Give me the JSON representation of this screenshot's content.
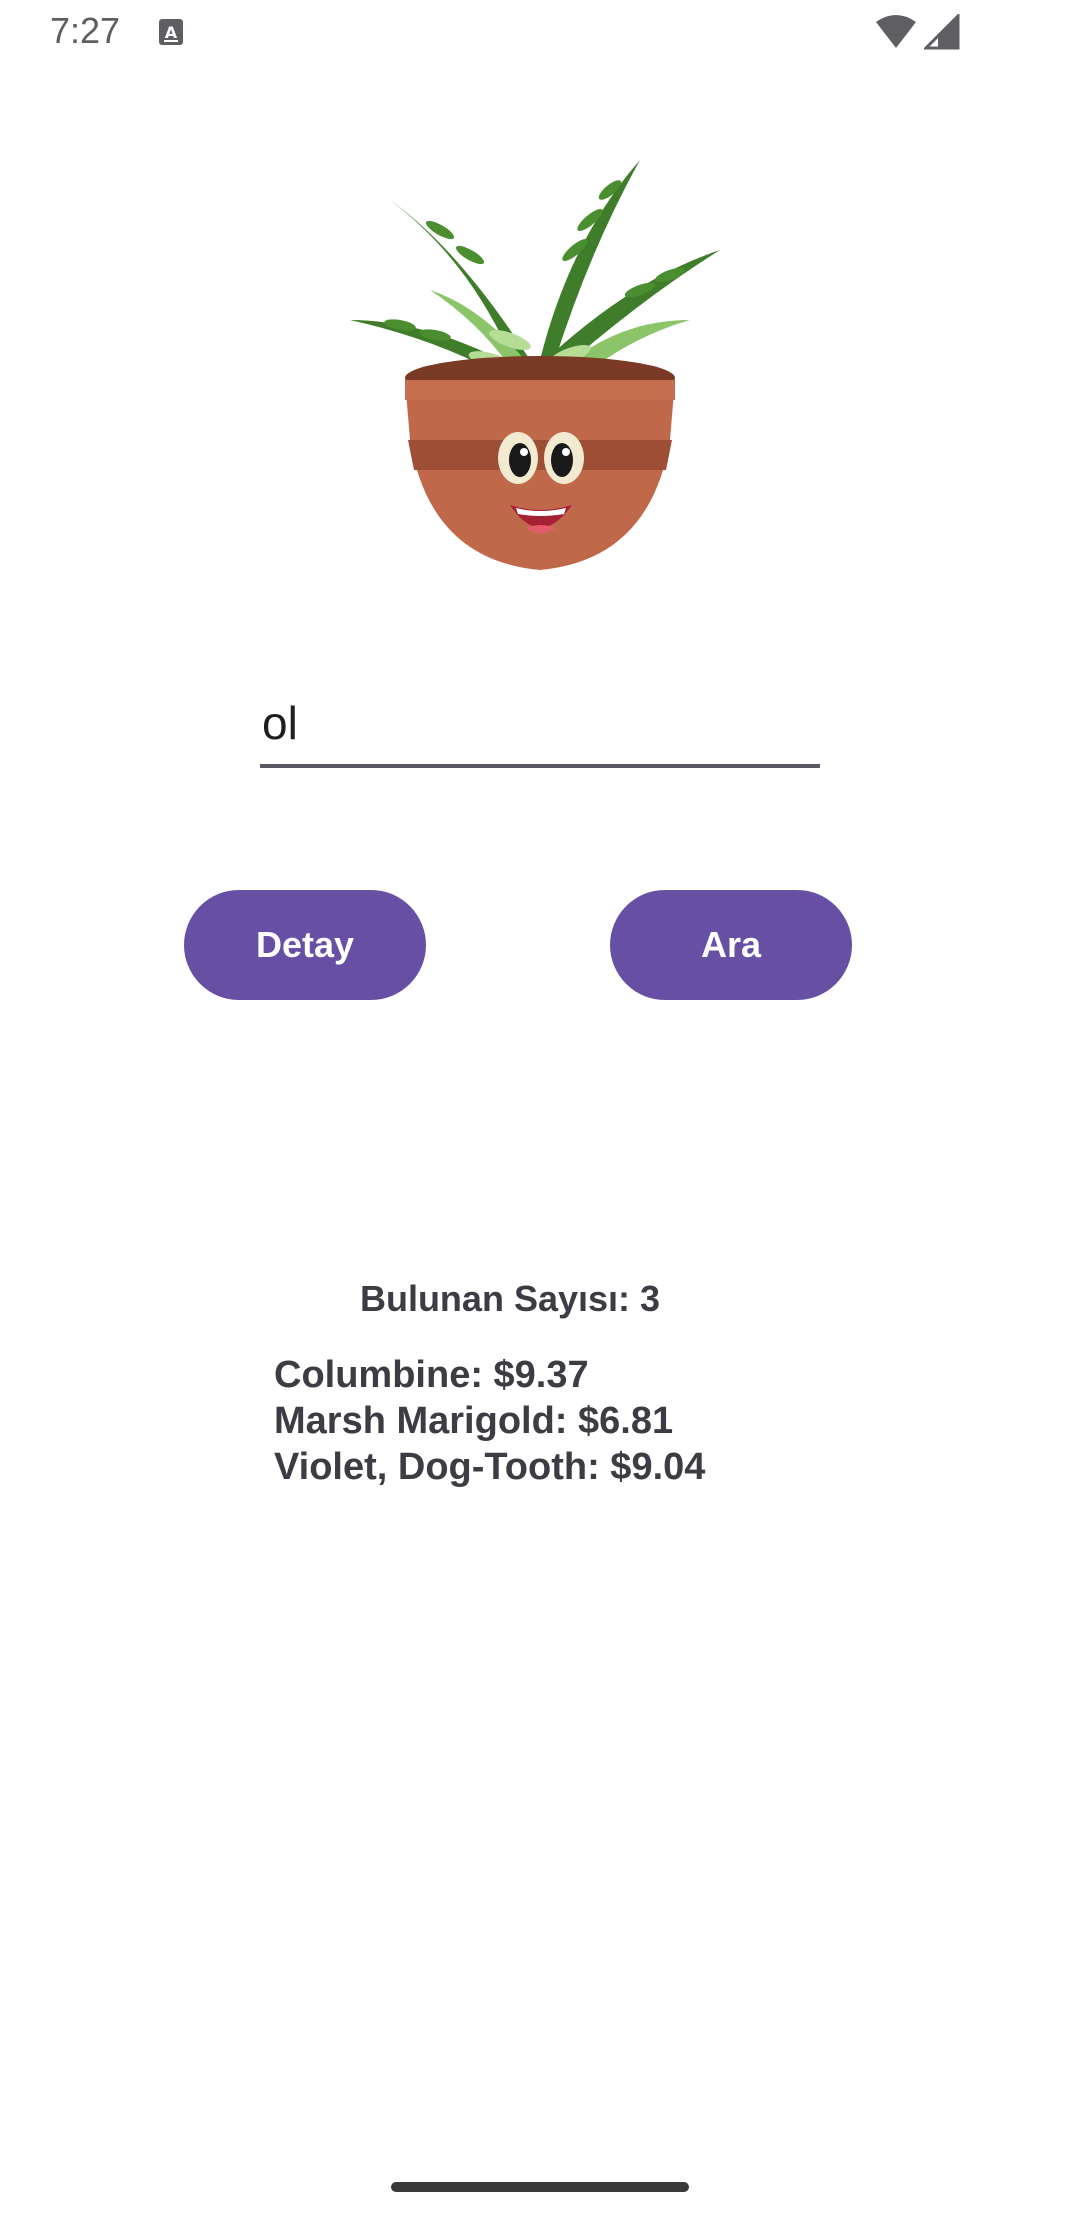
{
  "status_bar": {
    "time": "7:27",
    "icons": [
      "text-a-icon",
      "wifi-icon",
      "signal-icon"
    ]
  },
  "illustration": {
    "icon": "smiling-potted-fern-icon"
  },
  "search": {
    "value": "ol",
    "placeholder": ""
  },
  "buttons": {
    "detay_label": "Detay",
    "ara_label": "Ara"
  },
  "results": {
    "count_text": "Bulunan Sayısı: 3",
    "items": [
      "Columbine: $9.37",
      "Marsh Marigold: $6.81",
      "Violet, Dog-Tooth: $9.04"
    ]
  },
  "colors": {
    "accent": "#6750a4",
    "text": "#3e3b45",
    "underline": "#5b5866"
  }
}
